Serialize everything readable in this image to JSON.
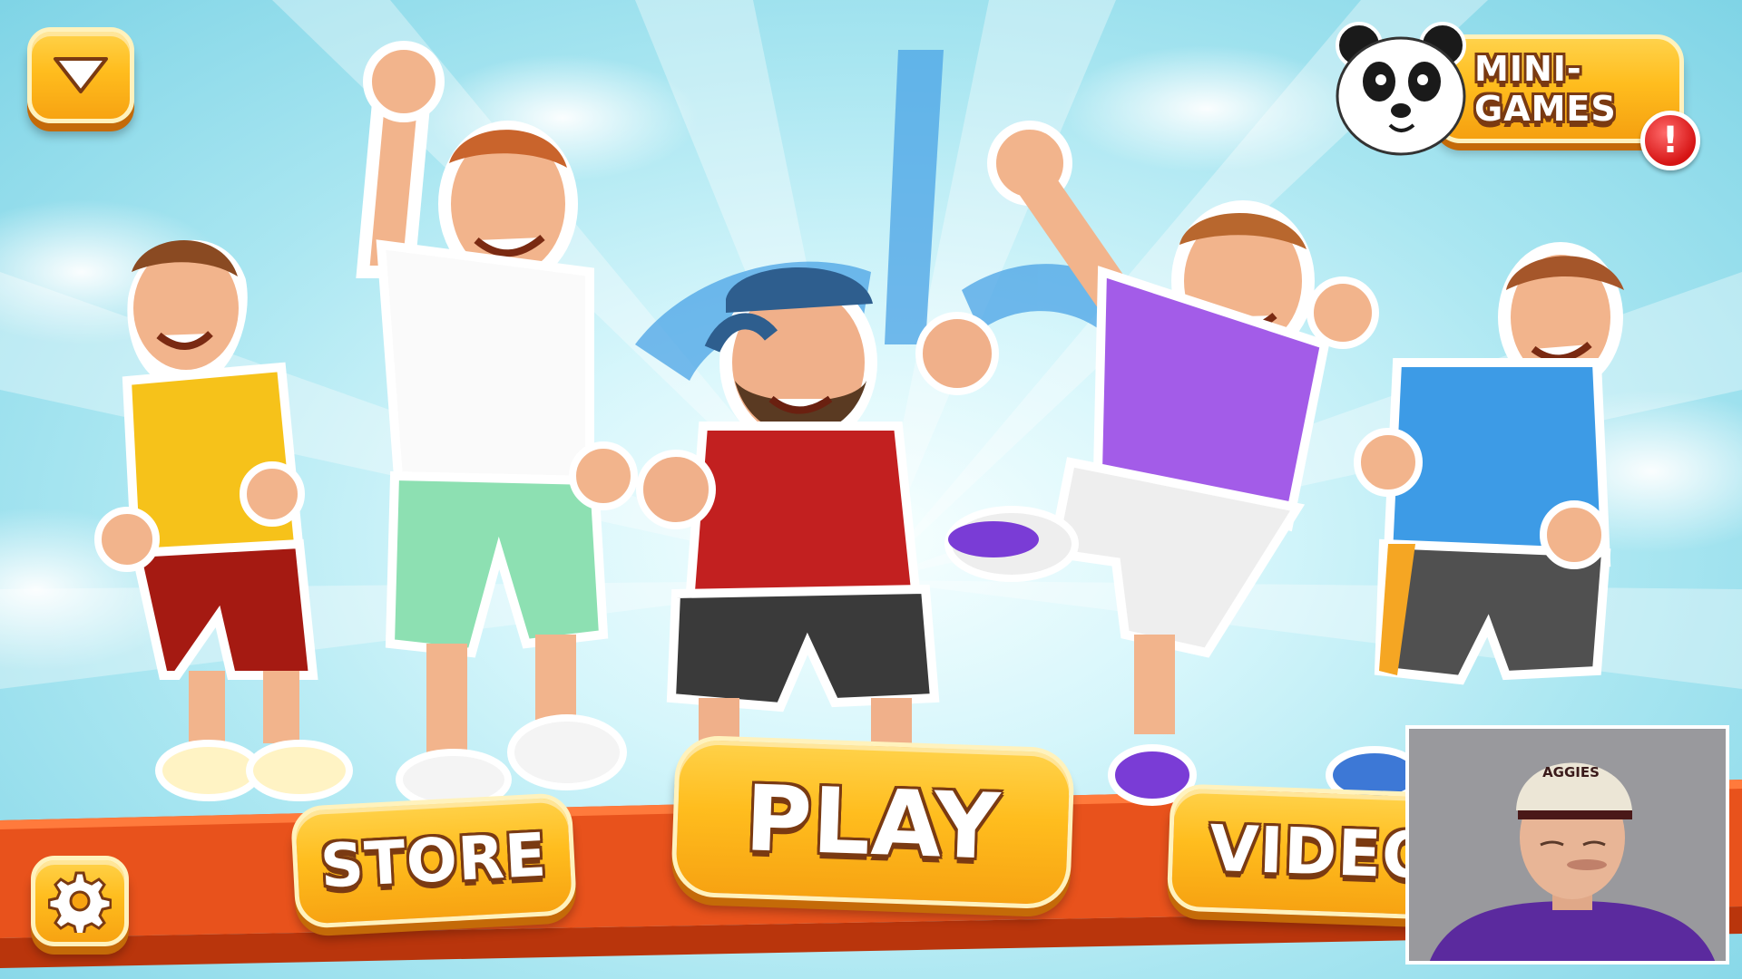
{
  "buttons": {
    "store": "STORE",
    "play": "PLAY",
    "videos": "VIDEOS",
    "mini_games": "MINI-GAMES",
    "alert": "!"
  },
  "icons": {
    "menu": "chevron-down-icon",
    "settings": "gear-icon",
    "mini_games": "panda-icon",
    "alert": "exclamation-icon"
  },
  "webcam": {
    "cap_text": "AGGIES"
  },
  "colors": {
    "button_yellow": "#ffbd1e",
    "button_outline": "#7a3a12",
    "banner_orange": "#e8521c",
    "sky": "#a9e6f1",
    "alert_red": "#d61414"
  }
}
